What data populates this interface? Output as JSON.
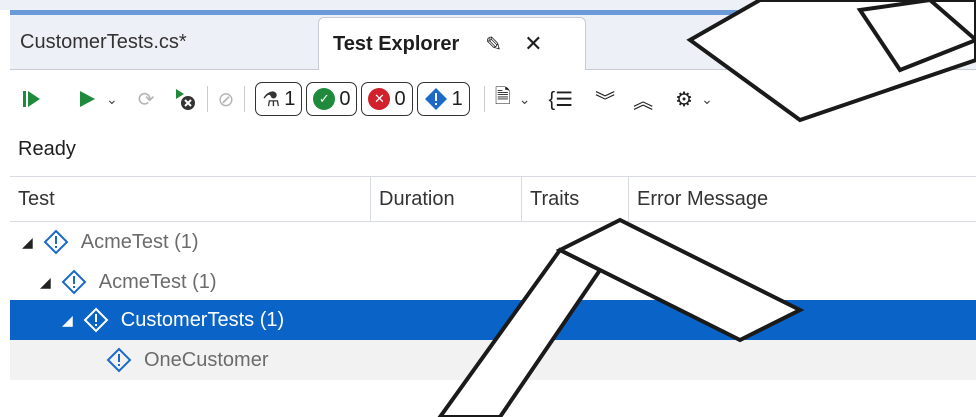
{
  "tabs": [
    {
      "label": "CustomerTests.cs*",
      "active": false
    },
    {
      "label": "Test Explorer",
      "active": true
    }
  ],
  "toolbar": {
    "counters": [
      {
        "icon": "flask-icon",
        "value": "1",
        "color": "#333333"
      },
      {
        "icon": "check-circle-icon",
        "value": "0",
        "color": "#1f8a3b"
      },
      {
        "icon": "x-circle-icon",
        "value": "0",
        "color": "#d1222c"
      },
      {
        "icon": "warning-diamond-icon",
        "value": "1",
        "color": "#1b6ac9"
      }
    ]
  },
  "status": "Ready",
  "columns": [
    "Test",
    "Duration",
    "Traits",
    "Error Message"
  ],
  "tree": [
    {
      "label": "AcmeTest (1)",
      "level": 0,
      "selected": false
    },
    {
      "label": "AcmeTest (1)",
      "level": 1,
      "selected": false
    },
    {
      "label": "CustomerTests (1)",
      "level": 2,
      "selected": true
    },
    {
      "label": "OneCustomer",
      "level": 3,
      "selected": false
    }
  ],
  "colors": {
    "accent": "#0a64c8",
    "run": "#1f8a3b",
    "fail": "#d1222c",
    "warn": "#1b6ac9"
  }
}
